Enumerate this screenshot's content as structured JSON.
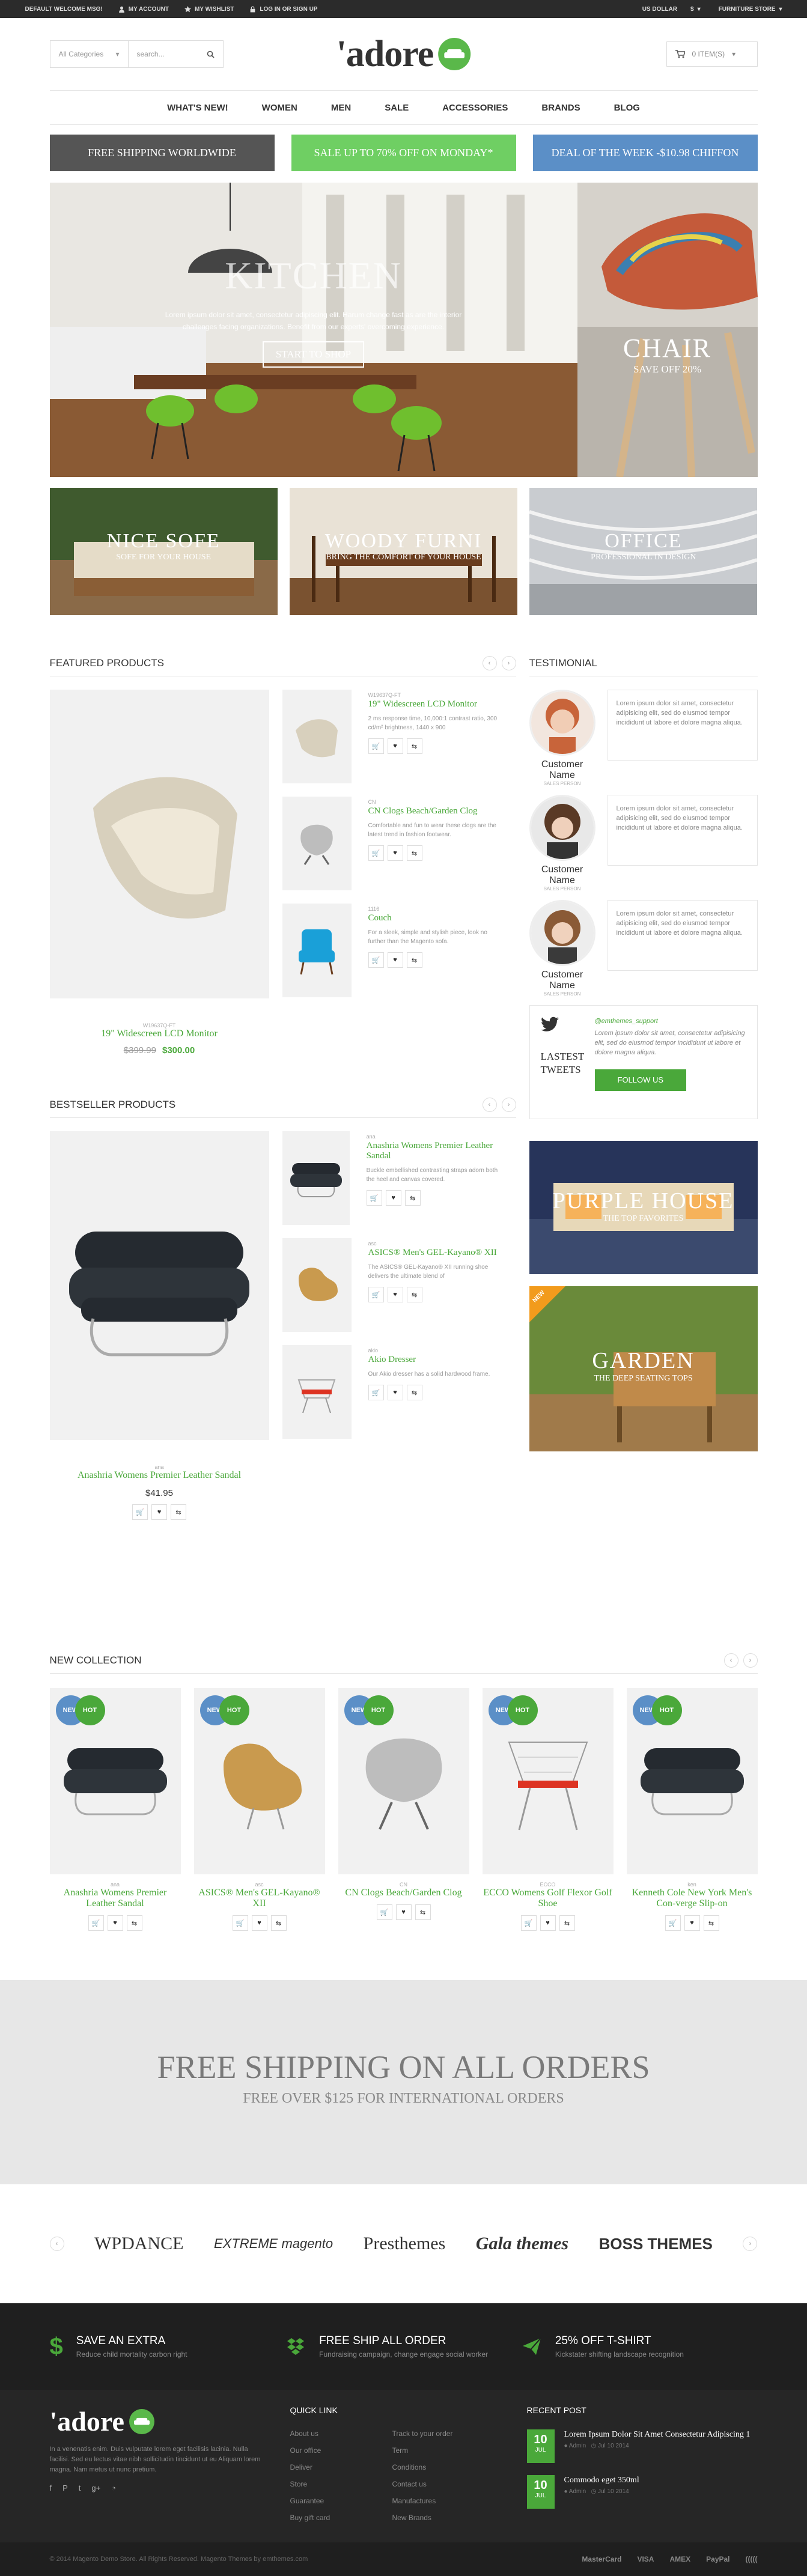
{
  "topbar": {
    "welcome": "DEFAULT WELCOME MSG!",
    "account": "MY ACCOUNT",
    "wishlist": "MY WISHLIST",
    "login": "LOG IN OR SIGN UP",
    "currency": "US DOLLAR",
    "currency_symbol": "$",
    "store": "FURNITURE STORE"
  },
  "header": {
    "category_select": "All Categories",
    "search_placeholder": "search...",
    "logo": "'adore",
    "cart": "0 ITEM(S)"
  },
  "nav": [
    "WHAT'S NEW!",
    "WOMEN",
    "MEN",
    "SALE",
    "ACCESSORIES",
    "BRANDS",
    "BLOG"
  ],
  "promos": [
    {
      "label": "FREE SHIPPING WORLDWIDE",
      "color": "#555555"
    },
    {
      "label": "SALE UP TO 70% OFF ON MONDAY*",
      "color": "#6fcf63"
    },
    {
      "label": "DEAL OF THE WEEK -$10.98 CHIFFON",
      "color": "#5b8fc7"
    }
  ],
  "hero": {
    "title": "KITCHEN",
    "text": "Lorem ipsum dolor sit amet, consectetur adipiscing elit. Harum change fast as are the interior challenges facing organizations. Benefit from our experts' overcoming experience.",
    "button": "START TO SHOP",
    "side_title": "CHAIR",
    "side_sub": "SAVE OFF 20%"
  },
  "trio": [
    {
      "title": "NICE SOFE",
      "sub": "SOFE FOR YOUR HOUSE"
    },
    {
      "title": "WOODY FURNI",
      "sub": "BRING THE COMFORT OF YOUR HOUSE"
    },
    {
      "title": "OFFICE",
      "sub": "PROFESSIONAL IN DESIGN"
    }
  ],
  "featured": {
    "heading": "FEATURED PRODUCTS",
    "main": {
      "sku": "W19637Q-FT",
      "name": "19\" Widescreen LCD Monitor",
      "old_price": "$399.99",
      "price": "$300.00"
    },
    "items": [
      {
        "sku": "W19637Q-FT",
        "name": "19\" Widescreen LCD Monitor",
        "desc": "2 ms response time, 10,000:1 contrast ratio, 300 cd/m² brightness, 1440 x 900"
      },
      {
        "sku": "CN",
        "name": "CN Clogs Beach/Garden Clog",
        "desc": "Comfortable and fun to wear these clogs are the latest trend in fashion footwear."
      },
      {
        "sku": "1116",
        "name": "Couch",
        "desc": "For a sleek, simple and stylish piece, look no further than the Magento sofa."
      }
    ]
  },
  "bestseller": {
    "heading": "BESTSELLER PRODUCTS",
    "main": {
      "sku": "ana",
      "name": "Anashria Womens Premier Leather Sandal",
      "price": "$41.95"
    },
    "items": [
      {
        "sku": "ana",
        "name": "Anashria Womens Premier Leather Sandal",
        "desc": "Buckle embellished contrasting straps adorn both the heel and canvas covered."
      },
      {
        "sku": "asc",
        "name": "ASICS® Men's GEL-Kayano® XII",
        "desc": "The ASICS® GEL-Kayano® XII running shoe delivers the ultimate blend of"
      },
      {
        "sku": "akio",
        "name": "Akio Dresser",
        "desc": "Our Akio dresser has a solid hardwood frame."
      }
    ]
  },
  "testimonial": {
    "heading": "TESTIMONIAL",
    "items": [
      {
        "name": "Customer Name",
        "job": "SALES PERSON",
        "text": "Lorem ipsum dolor sit amet, consectetur adipisicing elit, sed do eiusmod tempor incididunt ut labore et dolore magna aliqua."
      },
      {
        "name": "Customer Name",
        "job": "SALES PERSON",
        "text": "Lorem ipsum dolor sit amet, consectetur adipisicing elit, sed do eiusmod tempor incididunt ut labore et dolore magna aliqua."
      },
      {
        "name": "Customer Name",
        "job": "SALES PERSON",
        "text": "Lorem ipsum dolor sit amet, consectetur adipisicing elit, sed do eiusmod tempor incididunt ut labore et dolore magna aliqua."
      }
    ]
  },
  "tweets": {
    "title": "LASTEST TWEETS",
    "handle": "@emthemes_support",
    "text": "Lorem ipsum dolor sit amet, consectetur adipisicing elit, sed do eiusmod tempor incididunt ut labore et dolore magna aliqua.",
    "button": "FOLLOW US"
  },
  "side_banners": [
    {
      "title": "PURPLE HOUSE",
      "sub": "THE TOP FAVORITES"
    },
    {
      "title": "GARDEN",
      "sub": "THE DEEP SEATING TOPS",
      "ribbon": "NEW"
    }
  ],
  "new_collection": {
    "heading": "NEW COLLECTION",
    "badge_new": "NEW",
    "badge_hot": "HOT",
    "items": [
      {
        "sku": "ana",
        "name": "Anashria Womens Premier Leather Sandal"
      },
      {
        "sku": "asc",
        "name": "ASICS® Men's GEL-Kayano® XII"
      },
      {
        "sku": "CN",
        "name": "CN Clogs Beach/Garden Clog"
      },
      {
        "sku": "ECCO",
        "name": "ECCO Womens Golf Flexor Golf Shoe"
      },
      {
        "sku": "ken",
        "name": "Kenneth Cole New York Men's Con-verge Slip-on"
      }
    ]
  },
  "free_shipping": {
    "title": "FREE SHIPPING ON ALL ORDERS",
    "sub": "FREE OVER $125 FOR INTERNATIONAL ORDERS"
  },
  "brands": [
    "WPDANCE",
    "EXTREME magento",
    "Presthemes",
    "Gala themes",
    "BOSS THEMES"
  ],
  "footer_features": [
    {
      "title": "SAVE AN EXTRA",
      "desc": "Reduce child mortality carbon right"
    },
    {
      "title": "FREE SHIP ALL ORDER",
      "desc": "Fundraising campaign, change engage social worker"
    },
    {
      "title": "25% OFF T-SHIRT",
      "desc": "Kickstater shifting landscape recognition"
    }
  ],
  "footer": {
    "logo": "'adore",
    "about": "In a venenatis enim. Duis vulputate lorem eget facilisis lacinia. Nulla facilisi. Sed eu lectus vitae nibh sollicitudin tincidunt ut eu Aliquam lorem magna. Nam metus ut nunc pretium.",
    "quick_link_title": "QUICK LINK",
    "links": [
      "About us",
      "Track to your order",
      "Our office",
      "Term",
      "Deliver",
      "Conditions",
      "Store",
      "Contact us",
      "Guarantee",
      "Manufactures",
      "Buy gift card",
      "New Brands"
    ],
    "recent_title": "RECENT POST",
    "posts": [
      {
        "day": "10",
        "month": "JUL",
        "title": "Lorem Ipsum Dolor Sit Amet Consectetur Adipiscing 1",
        "meta": "Admin",
        "date": "Jul 10 2014"
      },
      {
        "day": "10",
        "month": "JUL",
        "title": "Commodo eget 350ml",
        "meta": "Admin",
        "date": "Jul 10 2014"
      }
    ],
    "copyright": "© 2014 Magento Demo Store. All Rights Reserved. Magento Themes by emthemes.com",
    "payments": [
      "MasterCard",
      "VISA",
      "AMEX",
      "PayPal",
      "((((("
    ]
  },
  "colors": {
    "green": "#4aa83a",
    "dark": "#2b2b2b"
  }
}
